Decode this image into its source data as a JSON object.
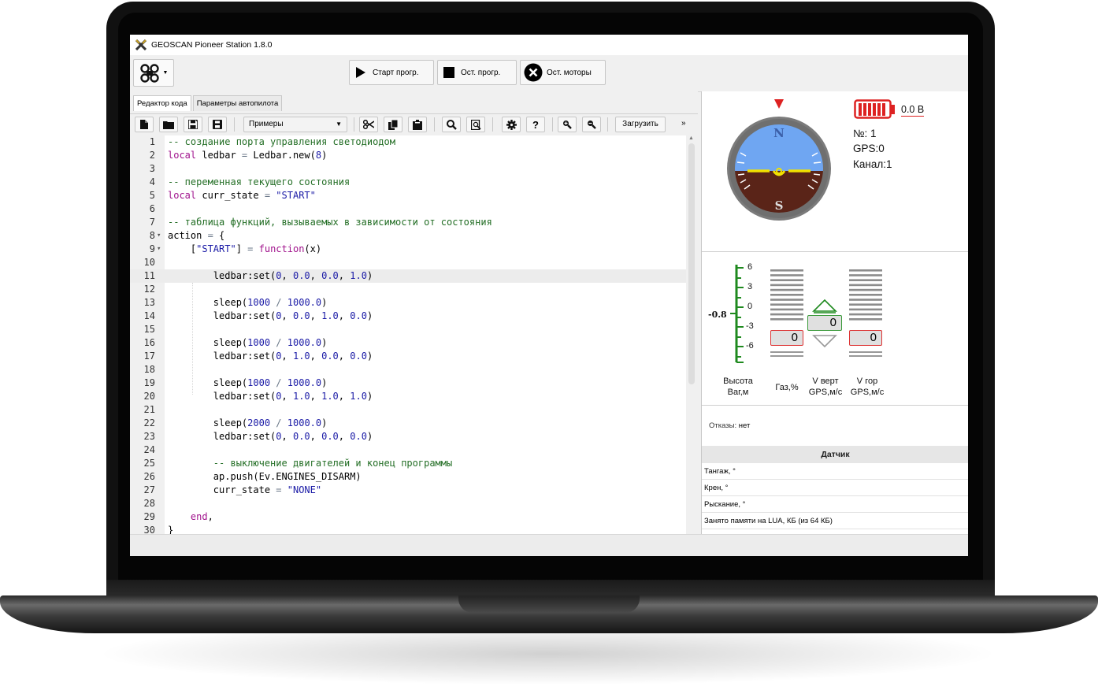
{
  "window": {
    "title": "GEOSCAN Pioneer Station 1.8.0"
  },
  "toolbar": {
    "start_program": "Старт прогр.",
    "stop_program": "Ост. прогр.",
    "stop_motors": "Ост. моторы"
  },
  "tabs": [
    "Редактор кода",
    "Параметры автопилота"
  ],
  "editor_toolbar": {
    "examples_label": "Примеры",
    "load_label": "Загрузить",
    "more_label": "»"
  },
  "code_lines": [
    {
      "n": "1",
      "t": "-- создание порта управления светодиодом"
    },
    {
      "n": "2",
      "t": "local ledbar = Ledbar.new(8)"
    },
    {
      "n": "3",
      "t": ""
    },
    {
      "n": "4",
      "t": "-- переменная текущего состояния"
    },
    {
      "n": "5",
      "t": "local curr_state = \"START\""
    },
    {
      "n": "6",
      "t": ""
    },
    {
      "n": "7",
      "t": "-- таблица функций, вызываемых в зависимости от состояния"
    },
    {
      "n": "8",
      "t": "action = {"
    },
    {
      "n": "9",
      "t": "    [\"START\"] = function(x)"
    },
    {
      "n": "10",
      "t": ""
    },
    {
      "n": "11",
      "t": "        ledbar:set(0, 0.0, 0.0, 1.0)"
    },
    {
      "n": "12",
      "t": ""
    },
    {
      "n": "13",
      "t": "        sleep(1000 / 1000.0)"
    },
    {
      "n": "14",
      "t": "        ledbar:set(0, 0.0, 1.0, 0.0)"
    },
    {
      "n": "15",
      "t": ""
    },
    {
      "n": "16",
      "t": "        sleep(1000 / 1000.0)"
    },
    {
      "n": "17",
      "t": "        ledbar:set(0, 1.0, 0.0, 0.0)"
    },
    {
      "n": "18",
      "t": ""
    },
    {
      "n": "19",
      "t": "        sleep(1000 / 1000.0)"
    },
    {
      "n": "20",
      "t": "        ledbar:set(0, 1.0, 1.0, 1.0)"
    },
    {
      "n": "21",
      "t": ""
    },
    {
      "n": "22",
      "t": "        sleep(2000 / 1000.0)"
    },
    {
      "n": "23",
      "t": "        ledbar:set(0, 0.0, 0.0, 0.0)"
    },
    {
      "n": "24",
      "t": ""
    },
    {
      "n": "25",
      "t": "        -- выключение двигателей и конец программы"
    },
    {
      "n": "26",
      "t": "        ap.push(Ev.ENGINES_DISARM)"
    },
    {
      "n": "27",
      "t": "        curr_state = \"NONE\""
    },
    {
      "n": "28",
      "t": ""
    },
    {
      "n": "29",
      "t": "    end,"
    },
    {
      "n": "30",
      "t": "}"
    }
  ],
  "status": {
    "battery": "0.0 В",
    "number": "№: 1",
    "gps": "GPS:0",
    "channel": "Канал:1",
    "compass_n": "N",
    "compass_s": "S"
  },
  "gauges": {
    "altitude_value": "-0.8",
    "altitude_ticks": [
      "6",
      "3",
      "0",
      "-3",
      "-6"
    ],
    "throttle_value": "0",
    "v_vert_value": "0",
    "v_hor_value": "0",
    "labels": {
      "altitude": "Высота\nВаг,м",
      "throttle": "Газ,%",
      "v_vert": "V верт\nGPS,м/с",
      "v_hor": "V гор\nGPS,м/с"
    }
  },
  "failures": {
    "label": "Отказы:",
    "value": "нет"
  },
  "sensor_table": {
    "header": "Датчик",
    "rows": [
      "Тангаж, °",
      "Крен, °",
      "Рыскание, °",
      "Занято памяти на LUA, КБ (из 64 КБ)"
    ]
  },
  "colors": {
    "accent_red": "#d32020",
    "gauge_green": "#1f8a1f",
    "sky": "#6fa6f2",
    "ground": "#5a2418"
  }
}
